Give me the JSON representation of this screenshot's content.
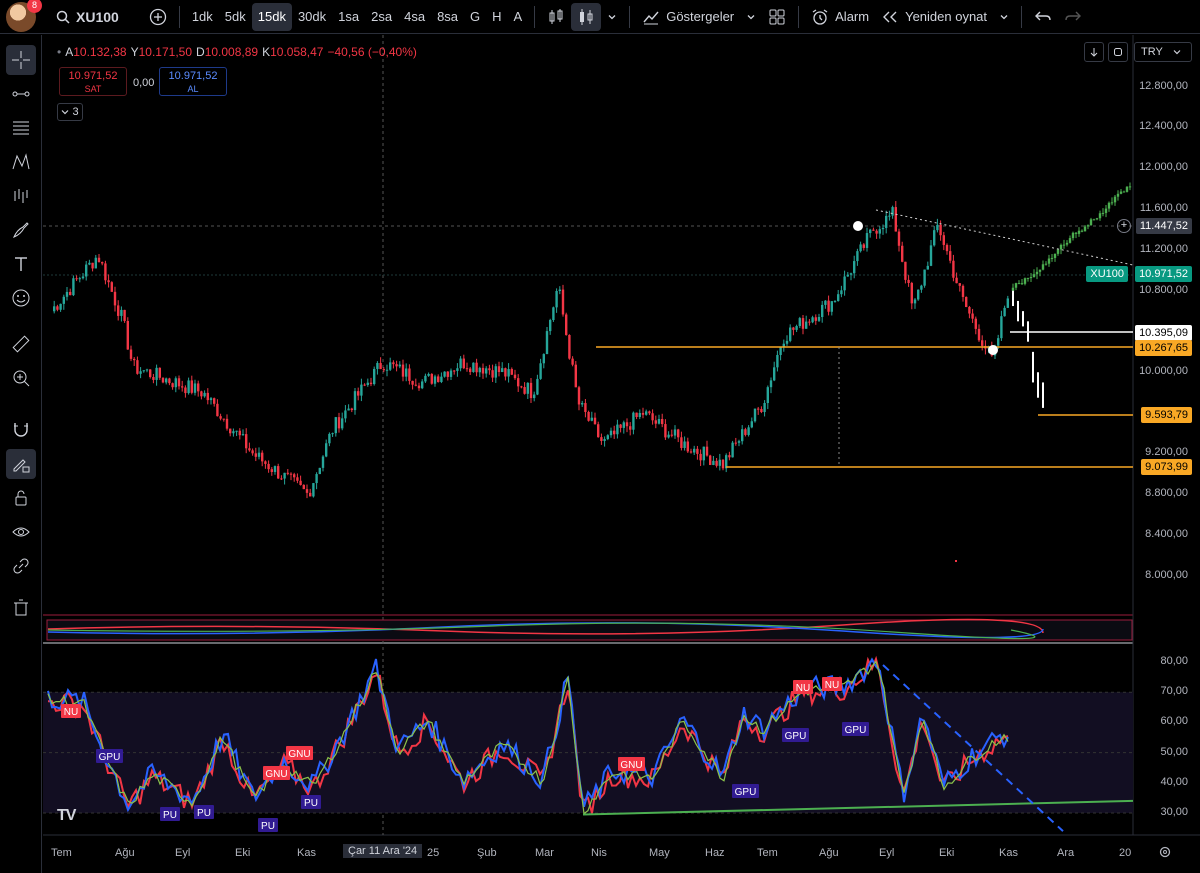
{
  "toolbar": {
    "avatar_badge": "8",
    "symbol": "XU100",
    "intervals": [
      "1dk",
      "5dk",
      "15dk",
      "30dk",
      "1sa",
      "2sa",
      "4sa",
      "8sa",
      "G",
      "H",
      "A"
    ],
    "active_interval": "15dk",
    "indicators_label": "Göstergeler",
    "alarm_label": "Alarm",
    "replay_label": "Yeniden oynat"
  },
  "legend": {
    "o_key": "A",
    "o_val": "10.132,38",
    "h_key": "Y",
    "h_val": "10.171,50",
    "l_key": "D",
    "l_val": "10.008,89",
    "c_key": "K",
    "c_val": "10.058,47",
    "change": "−40,56 (−0,40%)",
    "sell_price": "10.971,52",
    "sell_label": "SAT",
    "spread": "0,00",
    "buy_price": "10.971,52",
    "buy_label": "AL",
    "collapsed_count": "3"
  },
  "currency": "TRY",
  "price_axis": [
    "12.800,00",
    "12.400,00",
    "12.000,00",
    "11.600,00",
    "11.200,00",
    "10.800,00",
    "10.000,00",
    "9.600,00",
    "9.200,00",
    "8.800,00",
    "8.400,00",
    "8.000,00"
  ],
  "price_tags": {
    "crosshair": "11.447,52",
    "symbol_tag": "XU100",
    "last": "10.971,52",
    "level_1": "10.395,09",
    "level_2": "10.267,65",
    "level_3": "9.593,79",
    "level_4": "9.073,99"
  },
  "osc_axis": [
    "80,00",
    "70,00",
    "60,00",
    "50,00",
    "40,00",
    "30,00"
  ],
  "osc_labels": {
    "nu": "NU",
    "gnu": "GNU",
    "gpu": "GPU",
    "pu": "PU"
  },
  "time_axis": [
    "Tem",
    "Ağu",
    "Eyl",
    "Eki",
    "Kas",
    "Çar 11 Ara '24",
    "25",
    "Şub",
    "Mar",
    "Nis",
    "May",
    "Haz",
    "Tem",
    "Ağu",
    "Eyl",
    "Eki",
    "Kas",
    "Ara",
    "20"
  ],
  "watermark": "TV",
  "colors": {
    "up": "#26a69a",
    "down": "#f23645",
    "green_bull": "#4caf50",
    "level": "#f9a825",
    "buy_blue": "#2962ff",
    "osc_red": "#f23645",
    "osc_blue": "#2962ff",
    "osc_green": "#4caf50"
  }
}
